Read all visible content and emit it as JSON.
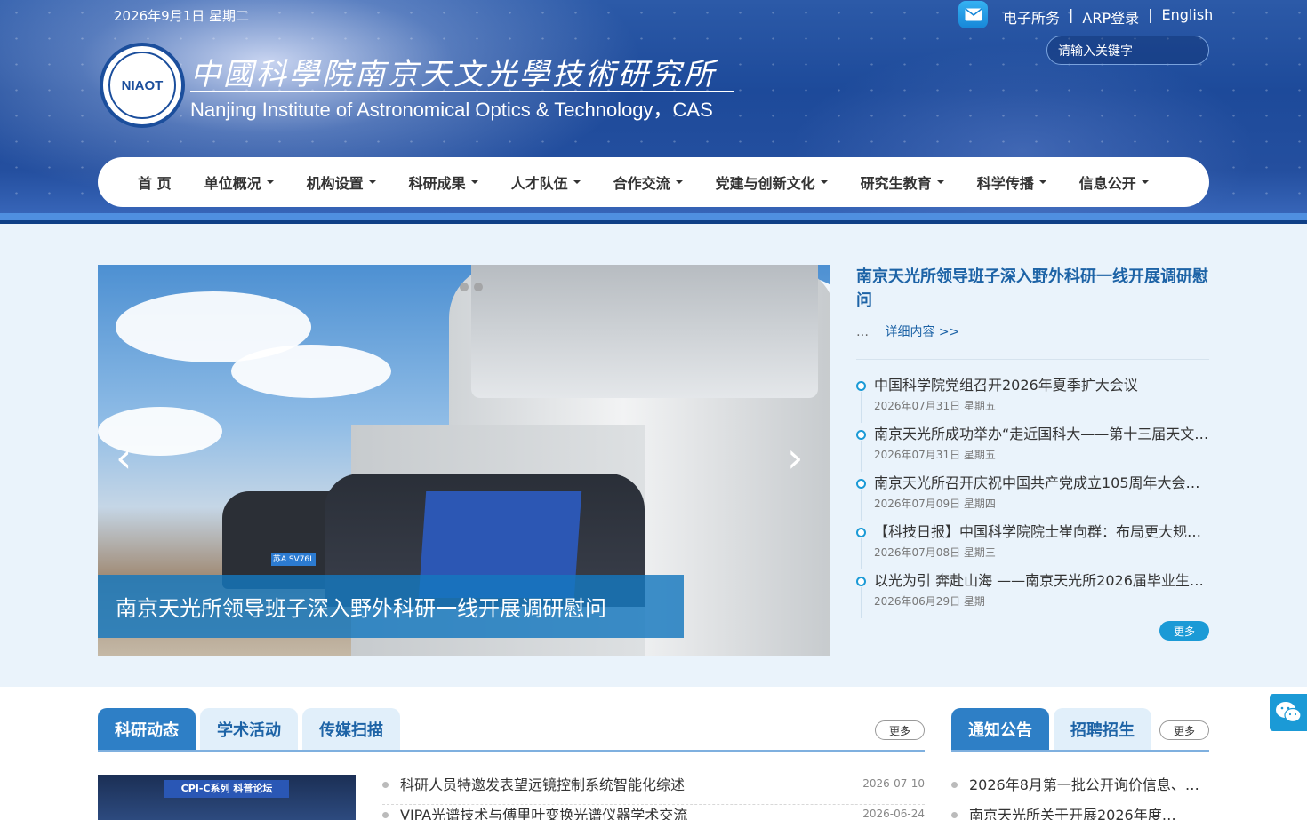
{
  "header": {
    "date": "2026年9月1日 星期二",
    "links": [
      "电子所务",
      "|",
      "ARP登录",
      "|",
      "English"
    ],
    "search_placeholder": "请输入关键字",
    "logo_mark": "NIAOT",
    "logo_cn": "中國科學院南京天文光學技術研究所",
    "logo_en": "Nanjing Institute of Astronomical Optics & Technology，CAS"
  },
  "nav": [
    "首 页",
    "单位概况",
    "机构设置",
    "科研成果",
    "人才队伍",
    "合作交流",
    "党建与创新文化",
    "研究生教育",
    "科学传播",
    "信息公开"
  ],
  "slider": {
    "caption": "南京天光所领导班子深入野外科研一线开展调研慰问",
    "prev": "‹",
    "next": "›",
    "plate": "苏A SV76L"
  },
  "feature": {
    "title": "南京天光所领导班子深入野外科研一线开展调研慰问",
    "ellipsis": "…",
    "more": "详细内容 >>"
  },
  "news": [
    {
      "title": "中国科学院党组召开2026年夏季扩大会议",
      "date": "2026年07月31日 星期五"
    },
    {
      "title": "南京天光所成功举办“走近国科大——第十三届天文…",
      "date": "2026年07月31日 星期五"
    },
    {
      "title": "南京天光所召开庆祝中国共产党成立105周年大会…",
      "date": "2026年07月09日 星期四"
    },
    {
      "title": "【科技日报】中国科学院院士崔向群：布局更大规…",
      "date": "2026年07月08日 星期三"
    },
    {
      "title": "以光为引 奔赴山海 ——南京天光所2026届毕业生…",
      "date": "2026年06月29日 星期一"
    }
  ],
  "news_more": "更多",
  "left_tabs": [
    "科研动态",
    "学术活动",
    "传媒扫描"
  ],
  "left_more": "更多",
  "photo_banner": "CPI-C系列 科普论坛",
  "research_list": [
    {
      "title": "科研人员特邀发表望远镜控制系统智能化综述",
      "date": "2026-07-10"
    },
    {
      "title": "VIPA光谱技术与傅里叶变换光谱仪器学术交流",
      "date": "2026-06-24"
    }
  ],
  "right_tabs": [
    "通知公告",
    "招聘招生"
  ],
  "right_more": "更多",
  "notice_list": [
    {
      "title": "2026年8月第一批公开询价信息、竞…"
    },
    {
      "title": "南京天光所关于开展2026年度…"
    }
  ],
  "colors": {
    "accent": "#1b9ad6",
    "nav_text": "#333333",
    "title_blue": "#1d63a6",
    "band": "#eaf3fb"
  }
}
